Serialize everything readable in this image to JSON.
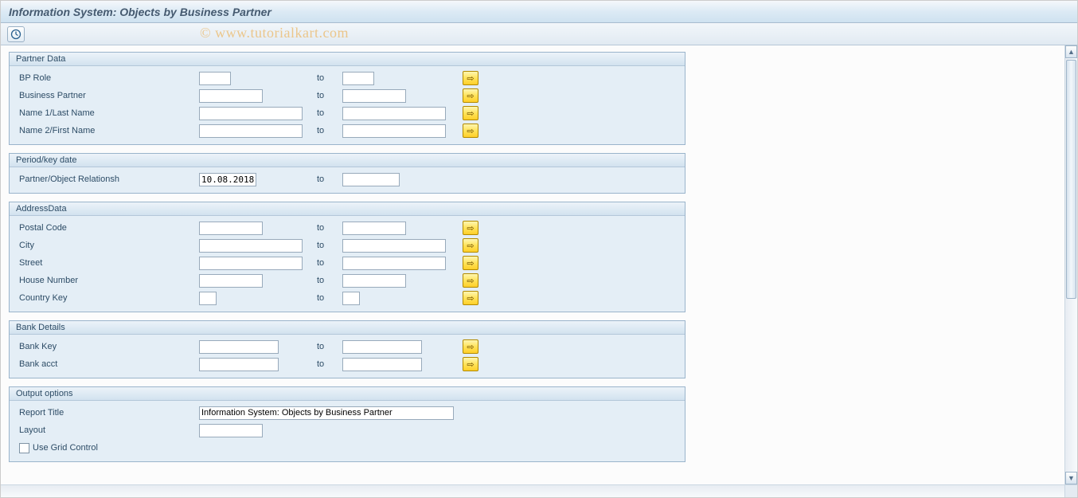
{
  "window": {
    "title": "Information System: Objects by Business Partner"
  },
  "watermark": "© www.tutorialkart.com",
  "to_label": "to",
  "groups": {
    "partner_data": {
      "title": "Partner Data",
      "bp_role": {
        "label": "BP Role",
        "from": "",
        "to": ""
      },
      "business_partner": {
        "label": "Business Partner",
        "from": "",
        "to": ""
      },
      "name1": {
        "label": "Name 1/Last Name",
        "from": "",
        "to": ""
      },
      "name2": {
        "label": "Name 2/First Name",
        "from": "",
        "to": ""
      }
    },
    "period": {
      "title": "Period/key date",
      "partner_object_rel": {
        "label": "Partner/Object Relationsh",
        "from": "10.08.2018",
        "to": ""
      }
    },
    "address": {
      "title": "AddressData",
      "postal_code": {
        "label": "Postal Code",
        "from": "",
        "to": ""
      },
      "city": {
        "label": "City",
        "from": "",
        "to": ""
      },
      "street": {
        "label": "Street",
        "from": "",
        "to": ""
      },
      "house_number": {
        "label": "House Number",
        "from": "",
        "to": ""
      },
      "country_key": {
        "label": "Country Key",
        "from": "",
        "to": ""
      }
    },
    "bank": {
      "title": "Bank Details",
      "bank_key": {
        "label": "Bank Key",
        "from": "",
        "to": ""
      },
      "bank_acct": {
        "label": "Bank acct",
        "from": "",
        "to": ""
      }
    },
    "output": {
      "title": "Output options",
      "report_title": {
        "label": "Report Title",
        "value": "Information System: Objects by Business Partner"
      },
      "layout": {
        "label": "Layout",
        "value": ""
      },
      "use_grid": {
        "label": "Use Grid Control",
        "checked": false
      }
    }
  }
}
